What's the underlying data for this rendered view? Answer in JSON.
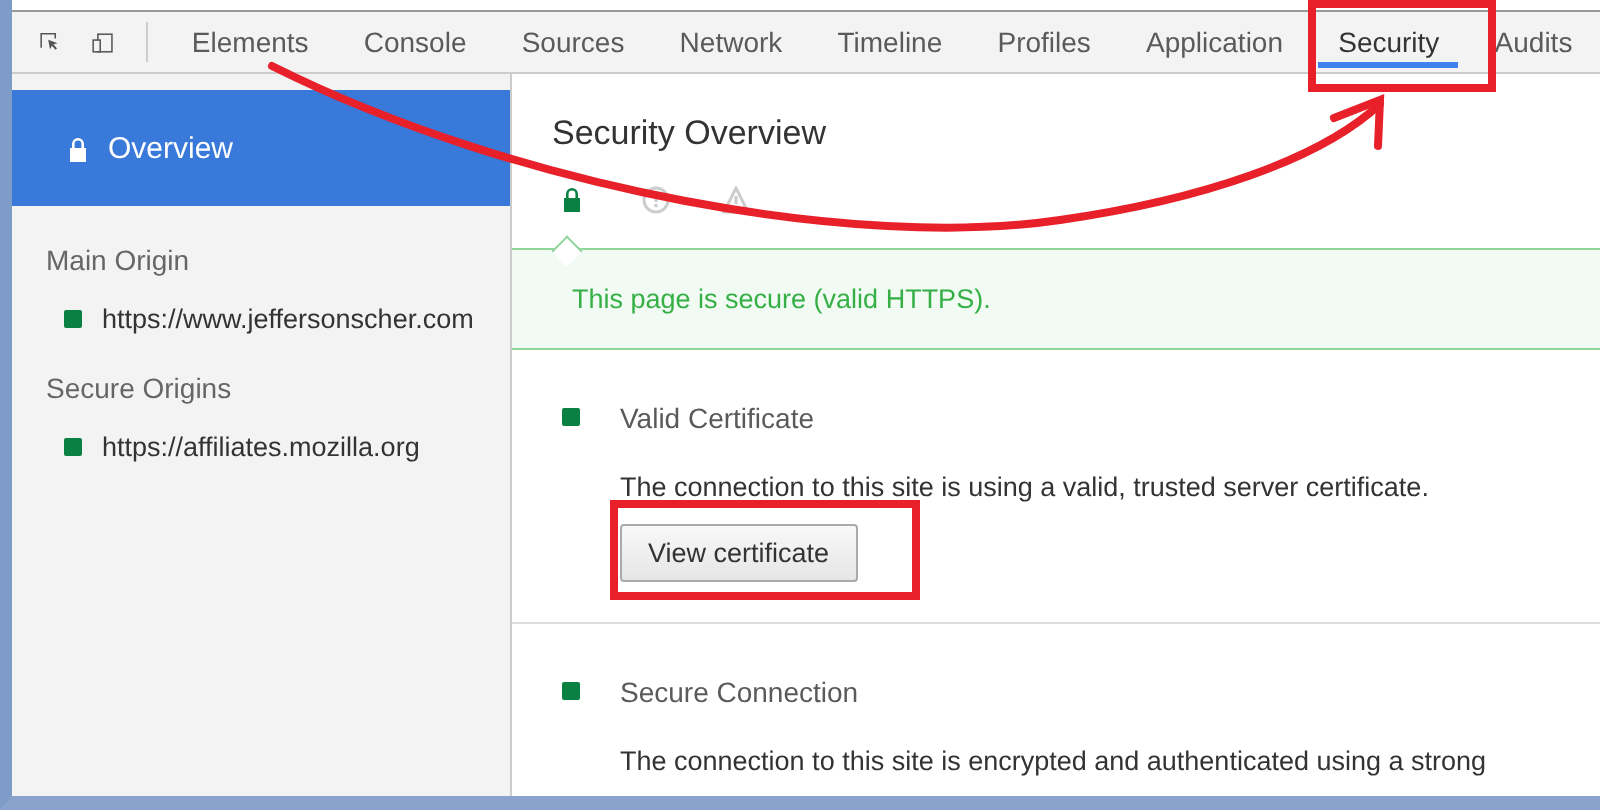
{
  "toolbar": {
    "tabs": [
      {
        "label": "Elements",
        "selected": false
      },
      {
        "label": "Console",
        "selected": false
      },
      {
        "label": "Sources",
        "selected": false
      },
      {
        "label": "Network",
        "selected": false
      },
      {
        "label": "Timeline",
        "selected": false
      },
      {
        "label": "Profiles",
        "selected": false
      },
      {
        "label": "Application",
        "selected": false
      },
      {
        "label": "Security",
        "selected": true
      },
      {
        "label": "Audits",
        "selected": false
      }
    ]
  },
  "sidebar": {
    "overview": {
      "label": "Overview",
      "selected": true
    },
    "groups": [
      {
        "heading": "Main Origin",
        "origins": [
          {
            "url": "https://www.jeffersonscher.com",
            "selected": false
          }
        ]
      },
      {
        "heading": "Secure Origins",
        "origins": [
          {
            "url": "https://affiliates.mozilla.org",
            "selected": false
          }
        ]
      }
    ]
  },
  "main": {
    "title": "Security Overview",
    "states": [
      {
        "kind": "secure",
        "selected": true
      },
      {
        "kind": "info",
        "selected": false
      },
      {
        "kind": "insecure",
        "selected": false
      }
    ],
    "banner": "This page is secure (valid HTTPS).",
    "sections": [
      {
        "title": "Valid Certificate",
        "description": "The connection to this site is using a valid, trusted server certificate.",
        "button": "View certificate"
      },
      {
        "title": "Secure Connection",
        "description": "The connection to this site is encrypted and authenticated using a strong"
      }
    ]
  }
}
